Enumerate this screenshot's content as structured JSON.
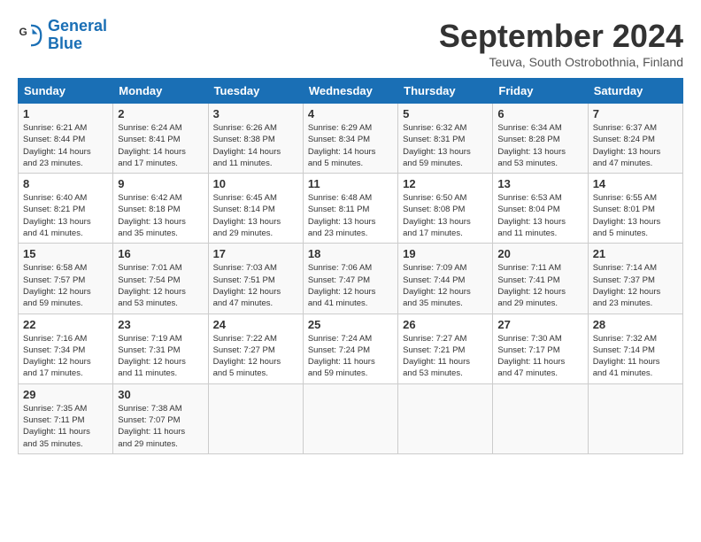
{
  "logo": {
    "line1": "General",
    "line2": "Blue"
  },
  "title": "September 2024",
  "location": "Teuva, South Ostrobothnia, Finland",
  "weekdays": [
    "Sunday",
    "Monday",
    "Tuesday",
    "Wednesday",
    "Thursday",
    "Friday",
    "Saturday"
  ],
  "weeks": [
    [
      {
        "day": "1",
        "info": "Sunrise: 6:21 AM\nSunset: 8:44 PM\nDaylight: 14 hours\nand 23 minutes."
      },
      {
        "day": "2",
        "info": "Sunrise: 6:24 AM\nSunset: 8:41 PM\nDaylight: 14 hours\nand 17 minutes."
      },
      {
        "day": "3",
        "info": "Sunrise: 6:26 AM\nSunset: 8:38 PM\nDaylight: 14 hours\nand 11 minutes."
      },
      {
        "day": "4",
        "info": "Sunrise: 6:29 AM\nSunset: 8:34 PM\nDaylight: 14 hours\nand 5 minutes."
      },
      {
        "day": "5",
        "info": "Sunrise: 6:32 AM\nSunset: 8:31 PM\nDaylight: 13 hours\nand 59 minutes."
      },
      {
        "day": "6",
        "info": "Sunrise: 6:34 AM\nSunset: 8:28 PM\nDaylight: 13 hours\nand 53 minutes."
      },
      {
        "day": "7",
        "info": "Sunrise: 6:37 AM\nSunset: 8:24 PM\nDaylight: 13 hours\nand 47 minutes."
      }
    ],
    [
      {
        "day": "8",
        "info": "Sunrise: 6:40 AM\nSunset: 8:21 PM\nDaylight: 13 hours\nand 41 minutes."
      },
      {
        "day": "9",
        "info": "Sunrise: 6:42 AM\nSunset: 8:18 PM\nDaylight: 13 hours\nand 35 minutes."
      },
      {
        "day": "10",
        "info": "Sunrise: 6:45 AM\nSunset: 8:14 PM\nDaylight: 13 hours\nand 29 minutes."
      },
      {
        "day": "11",
        "info": "Sunrise: 6:48 AM\nSunset: 8:11 PM\nDaylight: 13 hours\nand 23 minutes."
      },
      {
        "day": "12",
        "info": "Sunrise: 6:50 AM\nSunset: 8:08 PM\nDaylight: 13 hours\nand 17 minutes."
      },
      {
        "day": "13",
        "info": "Sunrise: 6:53 AM\nSunset: 8:04 PM\nDaylight: 13 hours\nand 11 minutes."
      },
      {
        "day": "14",
        "info": "Sunrise: 6:55 AM\nSunset: 8:01 PM\nDaylight: 13 hours\nand 5 minutes."
      }
    ],
    [
      {
        "day": "15",
        "info": "Sunrise: 6:58 AM\nSunset: 7:57 PM\nDaylight: 12 hours\nand 59 minutes."
      },
      {
        "day": "16",
        "info": "Sunrise: 7:01 AM\nSunset: 7:54 PM\nDaylight: 12 hours\nand 53 minutes."
      },
      {
        "day": "17",
        "info": "Sunrise: 7:03 AM\nSunset: 7:51 PM\nDaylight: 12 hours\nand 47 minutes."
      },
      {
        "day": "18",
        "info": "Sunrise: 7:06 AM\nSunset: 7:47 PM\nDaylight: 12 hours\nand 41 minutes."
      },
      {
        "day": "19",
        "info": "Sunrise: 7:09 AM\nSunset: 7:44 PM\nDaylight: 12 hours\nand 35 minutes."
      },
      {
        "day": "20",
        "info": "Sunrise: 7:11 AM\nSunset: 7:41 PM\nDaylight: 12 hours\nand 29 minutes."
      },
      {
        "day": "21",
        "info": "Sunrise: 7:14 AM\nSunset: 7:37 PM\nDaylight: 12 hours\nand 23 minutes."
      }
    ],
    [
      {
        "day": "22",
        "info": "Sunrise: 7:16 AM\nSunset: 7:34 PM\nDaylight: 12 hours\nand 17 minutes."
      },
      {
        "day": "23",
        "info": "Sunrise: 7:19 AM\nSunset: 7:31 PM\nDaylight: 12 hours\nand 11 minutes."
      },
      {
        "day": "24",
        "info": "Sunrise: 7:22 AM\nSunset: 7:27 PM\nDaylight: 12 hours\nand 5 minutes."
      },
      {
        "day": "25",
        "info": "Sunrise: 7:24 AM\nSunset: 7:24 PM\nDaylight: 11 hours\nand 59 minutes."
      },
      {
        "day": "26",
        "info": "Sunrise: 7:27 AM\nSunset: 7:21 PM\nDaylight: 11 hours\nand 53 minutes."
      },
      {
        "day": "27",
        "info": "Sunrise: 7:30 AM\nSunset: 7:17 PM\nDaylight: 11 hours\nand 47 minutes."
      },
      {
        "day": "28",
        "info": "Sunrise: 7:32 AM\nSunset: 7:14 PM\nDaylight: 11 hours\nand 41 minutes."
      }
    ],
    [
      {
        "day": "29",
        "info": "Sunrise: 7:35 AM\nSunset: 7:11 PM\nDaylight: 11 hours\nand 35 minutes."
      },
      {
        "day": "30",
        "info": "Sunrise: 7:38 AM\nSunset: 7:07 PM\nDaylight: 11 hours\nand 29 minutes."
      },
      {
        "day": "",
        "info": ""
      },
      {
        "day": "",
        "info": ""
      },
      {
        "day": "",
        "info": ""
      },
      {
        "day": "",
        "info": ""
      },
      {
        "day": "",
        "info": ""
      }
    ]
  ]
}
